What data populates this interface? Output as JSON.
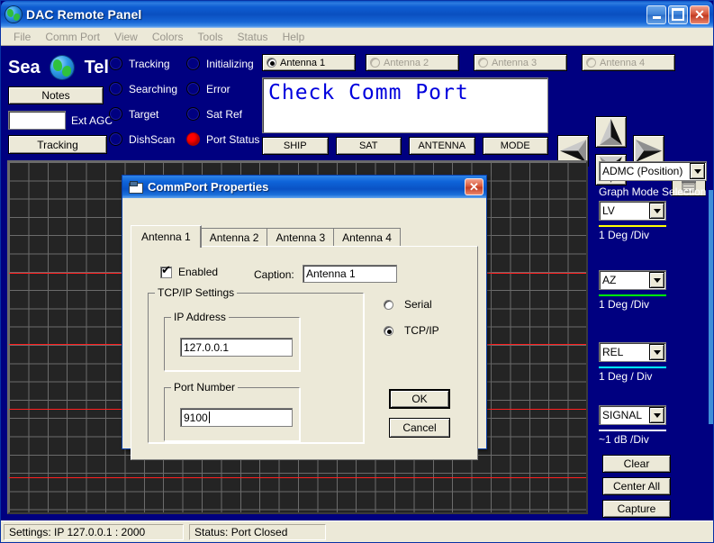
{
  "window": {
    "title": "DAC Remote Panel",
    "icon": "globe-icon",
    "minimize_label": "",
    "maximize_label": "",
    "close_label": "✕"
  },
  "menu": {
    "items": [
      "File",
      "Comm Port",
      "View",
      "Colors",
      "Tools",
      "Status",
      "Help"
    ]
  },
  "brand": {
    "word1": "Sea",
    "word2": "Tel"
  },
  "left_controls": {
    "notes_label": "Notes",
    "ext_agc_value": "",
    "ext_agc_label": "Ext AGC",
    "tracking_label": "Tracking"
  },
  "status_leds": [
    {
      "label": "Tracking",
      "on": false
    },
    {
      "label": "Initializing",
      "on": false
    },
    {
      "label": "Searching",
      "on": false
    },
    {
      "label": "Error",
      "on": false
    },
    {
      "label": "Target",
      "on": false
    },
    {
      "label": "Sat Ref",
      "on": false
    },
    {
      "label": "DishScan",
      "on": false
    },
    {
      "label": "Port Status",
      "on": true
    }
  ],
  "antenna_selector": [
    {
      "label": "Antenna 1",
      "selected": true,
      "enabled": true
    },
    {
      "label": "Antenna 2",
      "selected": false,
      "enabled": false
    },
    {
      "label": "Antenna 3",
      "selected": false,
      "enabled": false
    },
    {
      "label": "Antenna 4",
      "selected": false,
      "enabled": false
    }
  ],
  "display": {
    "text": "Check Comm Port",
    "text_color": "#0000dd"
  },
  "mode_buttons": [
    "SHIP",
    "SAT",
    "ANTENNA",
    "MODE"
  ],
  "jog_pad": {
    "up": "up-arrow-button",
    "down": "down-arrow-button",
    "left": "left-arrow-button",
    "right": "right-arrow-button",
    "antenna_icon": "antenna-dish-icon"
  },
  "graph": {
    "background": "#242424",
    "grid_color": "#6b6b6b",
    "reference_line_color": "#ff2020",
    "reference_lines_y_pct": [
      31.5,
      52.0,
      70.5,
      90.0
    ]
  },
  "right_panel": {
    "position_combo": "ADMC   (Position)",
    "graph_mode_label": "Graph Mode Selection",
    "traces": [
      {
        "combo": "LV",
        "scale": "1 Deg /Div",
        "color": "#ffff00"
      },
      {
        "combo": "AZ",
        "scale": "1 Deg /Div",
        "color": "#00ff00"
      },
      {
        "combo": "REL",
        "scale": "1 Deg / Div",
        "color": "#00ffff"
      },
      {
        "combo": "SIGNAL",
        "scale": "~1 dB /Div",
        "color": "#ffffff"
      }
    ],
    "buttons": [
      "Clear",
      "Center All",
      "Capture"
    ]
  },
  "dialog": {
    "title": "CommPort Properties",
    "icon": "commport-icon",
    "close_label": "✕",
    "tabs": [
      {
        "label": "Antenna 1",
        "active": true
      },
      {
        "label": "Antenna 2",
        "active": false
      },
      {
        "label": "Antenna 3",
        "active": false
      },
      {
        "label": "Antenna 4",
        "active": false
      }
    ],
    "enabled_label": "Enabled",
    "enabled_checked": true,
    "caption_label": "Caption:",
    "caption_value": "Antenna 1",
    "tcp_group_title": "TCP/IP Settings",
    "ip_group_title": "IP Address",
    "ip_value": "127.0.0.1",
    "port_group_title": "Port Number",
    "port_value": "9100",
    "conn_serial_label": "Serial",
    "conn_tcpip_label": "TCP/IP",
    "conn_selected": "TCP/IP",
    "ok_label": "OK",
    "cancel_label": "Cancel"
  },
  "statusbar": {
    "settings": "Settings: IP  127.0.0.1 : 2000",
    "status": "Status: Port Closed"
  }
}
